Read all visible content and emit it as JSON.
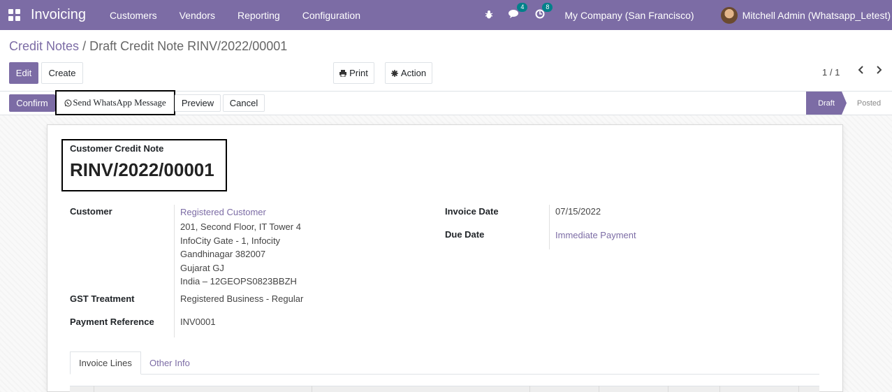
{
  "navbar": {
    "brand": "Invoicing",
    "menu": [
      "Customers",
      "Vendors",
      "Reporting",
      "Configuration"
    ],
    "messages_count": "4",
    "activities_count": "8",
    "company": "My Company (San Francisco)",
    "user": "Mitchell Admin (Whatsapp_Letest)"
  },
  "breadcrumb": {
    "parent": "Credit Notes",
    "separator": "/",
    "current": "Draft Credit Note RINV/2022/00001"
  },
  "buttons": {
    "edit": "Edit",
    "create": "Create",
    "print": "Print",
    "action": "Action"
  },
  "pager": {
    "value": "1 / 1"
  },
  "statusbar": {
    "confirm": "Confirm",
    "whatsapp": "Send WhatsApp Message",
    "preview": "Preview",
    "cancel": "Cancel",
    "stages": [
      "Draft",
      "Posted"
    ],
    "active_stage": "Draft"
  },
  "form": {
    "doc_type": "Customer Credit Note",
    "doc_name": "RINV/2022/00001",
    "customer_label": "Customer",
    "customer_name": "Registered Customer",
    "address": [
      "201, Second Floor, IT Tower 4",
      "InfoCity Gate - 1, Infocity",
      "Gandhinagar 382007",
      "Gujarat GJ",
      "India – 12GEOPS0823BBZH"
    ],
    "gst_label": "GST Treatment",
    "gst_value": "Registered Business - Regular",
    "payref_label": "Payment Reference",
    "payref_value": "INV0001",
    "invoice_date_label": "Invoice Date",
    "invoice_date_value": "07/15/2022",
    "due_date_label": "Due Date",
    "due_date_value": "Immediate Payment"
  },
  "tabs": {
    "invoice_lines": "Invoice Lines",
    "other_info": "Other Info"
  },
  "colors": {
    "brand": "#7c6ca5",
    "badge": "#01808a"
  }
}
